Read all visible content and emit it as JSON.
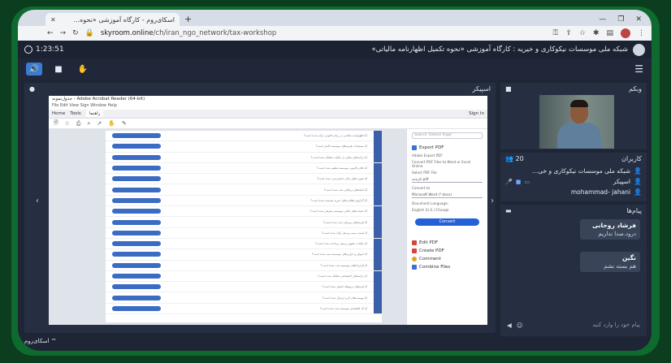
{
  "browser": {
    "tab_title": "اسکای‌روم - کارگاه آموزشی «نحوه...",
    "tab_close": "✕",
    "new_tab": "+",
    "url_host": "skyroom.online",
    "url_path": "/ch/iran_ngo_network/tax-workshop",
    "window_controls": [
      "—",
      "❐",
      "✕"
    ]
  },
  "app": {
    "timer": "1:23:51",
    "session_title": "شبکه ملی موسسات نیکوکاری و خیریه : کارگاه آموزشی «نحوه تکمیل اظهارنامه مالیاتی»"
  },
  "panels": {
    "share_title": "اسپیکر",
    "webcam_title": "وبکم",
    "users_title": "کاربران",
    "users_count": "20",
    "chat_title": "پیام‌ها"
  },
  "users": [
    {
      "name": "شبکه ملی موسسات نیکوکاری و خی...",
      "icon": "user-icon"
    },
    {
      "name": "اسپیکر",
      "icon": "user-icon"
    },
    {
      "name": "mohammad- jahani",
      "icon": "user-icon"
    }
  ],
  "chat": {
    "messages": [
      {
        "author": "فرشاد روحانی",
        "text": "درود.صدا نداریم"
      },
      {
        "author": "نگین",
        "text": "هم بسته نشم"
      }
    ],
    "input_placeholder": "پیام خود را وارد کنید"
  },
  "acrobat": {
    "window_title": "جدول‌نمونه - Adobe Acrobat Reader (64-bit)",
    "menu": "File  Edit  View  Sign  Window  Help",
    "home": "Home",
    "tools": "Tools",
    "doc_tab": "راهنما",
    "sign_in": "Sign In",
    "search_placeholder": "Search 'Detect Page'",
    "export_pdf": "Export PDF",
    "export_label": "Adobe Export PDF",
    "export_desc": "Convert PDF Files to Word or Excel Online",
    "select_file": "Select PDF File",
    "file_name": "کارنامه.pdf",
    "convert_to": "Convert to",
    "format": "Microsoft Word (*.docx)",
    "doc_language": "Document Language:",
    "language": "English (U.S.)  Change",
    "convert_btn": "Convert",
    "tools_list": [
      "Edit PDF",
      "Create PDF",
      "Comment",
      "Combine Files"
    ]
  },
  "rows": [
    "آیا اظهارنامه مالیاتی در زمان قانونی ارائه شده است؟",
    "آیا مستندات هزینه‌های موسسه کامل است؟",
    "آیا درآمدهای معاف از مالیات تفکیک شده است؟",
    "آیا دفاتر قانونی موسسه تنظیم شده است؟",
    "آیا صورت‌های مالی حسابرسی شده است؟",
    "آیا کمک‌های دریافتی ثبت شده است؟",
    "آیا گزارش فعالیت‌های خیریه ضمیمه شده است؟",
    "آیا حساب‌های بانکی موسسه معرفی شده است؟",
    "آیا هزینه‌های پرسنلی ثبت شده است؟",
    "آیا لیست بیمه پرسنل ارائه شده است؟",
    "آیا مالیات حقوق پرسنل پرداخت شده است؟",
    "آیا اموال و دارایی‌های موسسه ثبت شده است؟",
    "آیا قراردادهای موسسه ثبت شده است؟",
    "آیا درآمدهای اختصاصی تفکیک شده است؟",
    "آیا فرم‌های مربوطه تکمیل شده است؟",
    "آیا پیوست‌های لازم ارسال شده است؟",
    "آیا کد اقتصادی موسسه ثبت شده است؟"
  ],
  "watermark": "اسکای‌روم ™"
}
